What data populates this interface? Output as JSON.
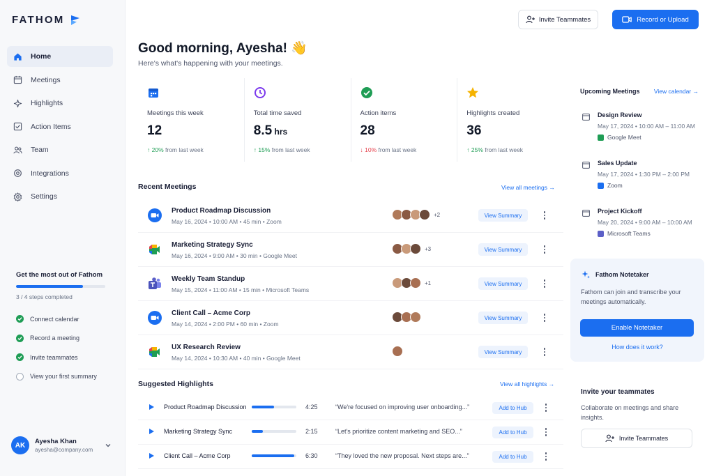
{
  "app": {
    "logo_text": "FATHOM"
  },
  "sidebar": {
    "items": [
      {
        "label": "Home",
        "icon": "home-icon"
      },
      {
        "label": "Meetings",
        "icon": "calendar-icon"
      },
      {
        "label": "Highlights",
        "icon": "sparkle-icon"
      },
      {
        "label": "Action Items",
        "icon": "checklist-icon"
      },
      {
        "label": "Team",
        "icon": "users-icon"
      },
      {
        "label": "Integrations",
        "icon": "gear-link-icon"
      },
      {
        "label": "Settings",
        "icon": "gear-icon"
      }
    ],
    "active_item": "Home",
    "onboarding": {
      "title": "Get the most out of Fathom",
      "progress_fraction": 0.75,
      "steps_text": "3 / 4 steps completed",
      "steps": [
        {
          "label": "Connect calendar",
          "done": true
        },
        {
          "label": "Record a meeting",
          "done": true
        },
        {
          "label": "Invite teammates",
          "done": true
        },
        {
          "label": "View your first summary",
          "done": false
        }
      ]
    },
    "user": {
      "initials": "AK",
      "name": "Ayesha Khan",
      "email": "ayesha@company.com"
    }
  },
  "header": {
    "invite_label": "Invite Teammates",
    "record_label": "Record or Upload",
    "greeting": "Good morning, Ayesha! 👋",
    "subtitle": "Here's what's happening with your meetings."
  },
  "stats": [
    {
      "label": "Meetings this week",
      "value": "12",
      "unit": "",
      "change": "20%",
      "direction": "up",
      "suffix": " from last week",
      "icon": "calendar-icon",
      "color": "#1b6ef0"
    },
    {
      "label": "Total time saved",
      "value": "8.5",
      "unit": " hrs",
      "change": "15%",
      "direction": "up",
      "suffix": " from last week",
      "icon": "clock-icon",
      "color": "#7c3aed"
    },
    {
      "label": "Action items",
      "value": "28",
      "unit": "",
      "change": "10%",
      "direction": "down",
      "suffix": " from last week",
      "icon": "check-circle-icon",
      "color": "#1f9d55"
    },
    {
      "label": "Highlights created",
      "value": "36",
      "unit": "",
      "change": "25%",
      "direction": "up",
      "suffix": " from last week",
      "icon": "star-icon",
      "color": "#f5b301"
    }
  ],
  "recent_meetings": {
    "title": "Recent Meetings",
    "view_all": "View all meetings →",
    "items": [
      {
        "title": "Product Roadmap Discussion",
        "date": "May 16, 2024",
        "time": "10:00 AM",
        "duration": "45 min",
        "platform": "Zoom",
        "extra": "+2",
        "faces": 4,
        "summary_label": "View Summary"
      },
      {
        "title": "Marketing Strategy Sync",
        "date": "May 16, 2024",
        "time": "9:00 AM",
        "duration": "30 min",
        "platform": "Google Meet",
        "extra": "+3",
        "faces": 3,
        "summary_label": "View Summary"
      },
      {
        "title": "Weekly Team Standup",
        "date": "May 15, 2024",
        "time": "11:00 AM",
        "duration": "15 min",
        "platform": "Microsoft Teams",
        "extra": "+1",
        "faces": 3,
        "summary_label": "View Summary"
      },
      {
        "title": "Client Call – Acme Corp",
        "date": "May 14, 2024",
        "time": "2:00 PM",
        "duration": "60 min",
        "platform": "Zoom",
        "extra": "",
        "faces": 3,
        "summary_label": "View Summary"
      },
      {
        "title": "UX Research Review",
        "date": "May 14, 2024",
        "time": "10:30 AM",
        "duration": "40 min",
        "platform": "Google Meet",
        "extra": "",
        "faces": 1,
        "summary_label": "View Summary"
      }
    ]
  },
  "suggested_highlights": {
    "title": "Suggested Highlights",
    "view_all": "View all highlights →",
    "items": [
      {
        "title": "Product Roadmap Discussion",
        "progress": 0.5,
        "duration": "4:25",
        "quote": "“We're focused on improving user onboarding...”",
        "action": "Add to Hub"
      },
      {
        "title": "Marketing Strategy Sync",
        "progress": 0.25,
        "duration": "2:15",
        "quote": "“Let's prioritize content marketing and SEO...”",
        "action": "Add to Hub"
      },
      {
        "title": "Client Call – Acme Corp",
        "progress": 0.95,
        "duration": "6:30",
        "quote": "“They loved the new proposal. Next steps are...”",
        "action": "Add to Hub"
      }
    ]
  },
  "upcoming": {
    "title": "Upcoming Meetings",
    "link": "View calendar →",
    "items": [
      {
        "name": "Design Review",
        "when": "May 17, 2024 • 10:00 AM – 11:00 AM",
        "app": "Google Meet",
        "app_color": "#1f9d55"
      },
      {
        "name": "Sales Update",
        "when": "May 17, 2024 • 1:30 PM – 2:00 PM",
        "app": "Zoom",
        "app_color": "#1b6ef0"
      },
      {
        "name": "Project Kickoff",
        "when": "May 20, 2024 • 9:00 AM – 10:00 AM",
        "app": "Microsoft Teams",
        "app_color": "#5b5fc7"
      }
    ]
  },
  "notetaker": {
    "title": "Fathom Notetaker",
    "description": "Fathom can join and transcribe your meetings automatically.",
    "button": "Enable Notetaker",
    "link": "How does it work?"
  },
  "invite_card": {
    "title": "Invite your teammates",
    "description": "Collaborate on meetings and share insights.",
    "button": "Invite Teammates"
  }
}
